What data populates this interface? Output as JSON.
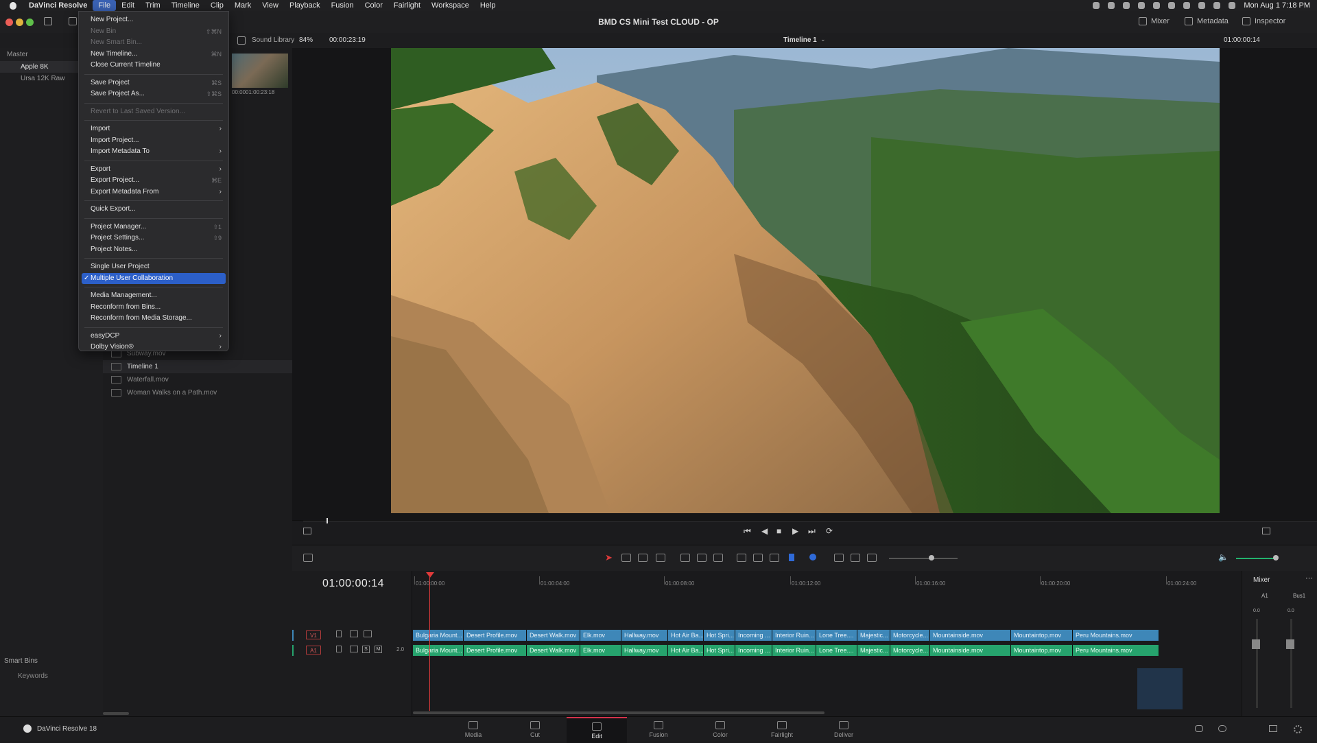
{
  "menubar": {
    "app": "DaVinci Resolve",
    "items": [
      "File",
      "Edit",
      "Trim",
      "Timeline",
      "Clip",
      "Mark",
      "View",
      "Playback",
      "Fusion",
      "Color",
      "Fairlight",
      "Workspace",
      "Help"
    ],
    "clock": "Mon Aug 1  7:18 PM"
  },
  "titlebar": {
    "project_title": "BMD CS Mini Test CLOUD - OP",
    "mixer": "Mixer",
    "metadata": "Metadata",
    "inspector": "Inspector"
  },
  "subbar": {
    "sound_library": "Sound Library",
    "zoom": "84%",
    "source_tc": "00:00:23:19",
    "timeline_name": "Timeline 1",
    "record_tc": "01:00:00:14"
  },
  "bins": {
    "master": "Master",
    "items": [
      "Apple 8K",
      "Ursa 12K Raw"
    ],
    "smart_bins": "Smart Bins",
    "keywords": "Keywords"
  },
  "media": {
    "thumb_tc_left": "00:00",
    "thumb_tc_right": "01:00:23:18",
    "clips": [
      "Subway.mov",
      "Timeline 1",
      "Waterfall.mov",
      "Woman Walks on a Path.mov"
    ]
  },
  "file_menu": {
    "groups": [
      [
        {
          "label": "New Project...",
          "shortcut": ""
        },
        {
          "label": "New Bin",
          "shortcut": "⇧⌘N",
          "disabled": true
        },
        {
          "label": "New Smart Bin...",
          "shortcut": "",
          "disabled": true
        },
        {
          "label": "New Timeline...",
          "shortcut": "⌘N"
        },
        {
          "label": "Close Current Timeline",
          "shortcut": ""
        }
      ],
      [
        {
          "label": "Save Project",
          "shortcut": "⌘S"
        },
        {
          "label": "Save Project As...",
          "shortcut": "⇧⌘S"
        }
      ],
      [
        {
          "label": "Revert to Last Saved Version...",
          "shortcut": "",
          "disabled": true
        }
      ],
      [
        {
          "label": "Import",
          "submenu": true
        },
        {
          "label": "Import Project...",
          "shortcut": ""
        },
        {
          "label": "Import Metadata To",
          "submenu": true
        }
      ],
      [
        {
          "label": "Export",
          "submenu": true
        },
        {
          "label": "Export Project...",
          "shortcut": "⌘E"
        },
        {
          "label": "Export Metadata From",
          "submenu": true
        }
      ],
      [
        {
          "label": "Quick Export...",
          "shortcut": ""
        }
      ],
      [
        {
          "label": "Project Manager...",
          "shortcut": "⇧1"
        },
        {
          "label": "Project Settings...",
          "shortcut": "⇧9"
        },
        {
          "label": "Project Notes...",
          "shortcut": ""
        }
      ],
      [
        {
          "label": "Single User Project",
          "shortcut": ""
        },
        {
          "label": "Multiple User Collaboration",
          "shortcut": "",
          "checked": true,
          "highlighted": true
        }
      ],
      [
        {
          "label": "Media Management...",
          "shortcut": ""
        },
        {
          "label": "Reconform from Bins...",
          "shortcut": ""
        },
        {
          "label": "Reconform from Media Storage...",
          "shortcut": ""
        }
      ],
      [
        {
          "label": "easyDCP",
          "submenu": true
        },
        {
          "label": "Dolby Vision®",
          "submenu": true
        }
      ]
    ]
  },
  "timeline": {
    "timecode": "01:00:00:14",
    "ruler": [
      "01:00:00:00",
      "01:00:04:00",
      "01:00:08:00",
      "01:00:12:00",
      "01:00:16:00",
      "01:00:20:00",
      "01:00:24:00"
    ],
    "v1": "V1",
    "a1": "A1",
    "a1_level": "2.0",
    "clips": [
      "Bulgaria Mount...",
      "Desert Profile.mov",
      "Desert Walk.mov",
      "Elk.mov",
      "Hallway.mov",
      "Hot Air Ba...",
      "Hot Spri...",
      "Incoming ...",
      "Interior Ruin...",
      "Lone Tree....",
      "Majestic...",
      "Motorcycle...",
      "Mountainside.mov",
      "Mountaintop.mov",
      "Peru Mountains.mov"
    ]
  },
  "mixer_panel": {
    "title": "Mixer",
    "a1": "A1",
    "bus1": "Bus1",
    "level_a1": "0.0",
    "level_bus": "0.0"
  },
  "pages": [
    "Media",
    "Cut",
    "Edit",
    "Fusion",
    "Color",
    "Fairlight",
    "Deliver"
  ],
  "active_page": "Edit",
  "footer": {
    "app_version": "DaVinci Resolve 18"
  },
  "colors": {
    "accent": "#2c5fc8",
    "playhead": "#e03a3a",
    "video_clip": "#3e87b8",
    "audio_clip": "#26a36d"
  }
}
